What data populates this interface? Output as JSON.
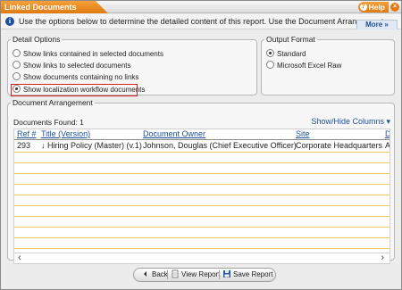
{
  "window": {
    "title": "Linked Documents",
    "help_label": "Help",
    "close_symbol": "×"
  },
  "info": {
    "text": "Use the options below to determine the detailed content of this report. Use the Document Arrangement",
    "more_label": "More »"
  },
  "detail_options": {
    "legend": "Detail Options",
    "items": [
      {
        "label": "Show links contained in selected documents",
        "checked": false
      },
      {
        "label": "Show links to selected documents",
        "checked": false
      },
      {
        "label": "Show documents containing no links",
        "checked": false
      },
      {
        "label": "Show localization workflow documents",
        "checked": true
      }
    ]
  },
  "output_format": {
    "legend": "Output Format",
    "items": [
      {
        "label": "Standard",
        "checked": true
      },
      {
        "label": "Microsoft Excel Raw",
        "checked": false
      }
    ]
  },
  "document_arrangement": {
    "legend": "Document Arrangement",
    "found_label": "Documents Found: 1",
    "show_hide_label": "Show/Hide Columns ▾",
    "columns": [
      "Ref #",
      "Title (Version)",
      "Document Owner",
      "Site",
      "De"
    ],
    "rows": [
      [
        "293",
        "↓ Hiring Policy (Master) (v.1)",
        "Johnson, Douglas (Chief Executive Officer)",
        "Corporate Headquarters",
        "Ac"
      ]
    ]
  },
  "buttons": {
    "back": "Back",
    "view_report": "View Report",
    "save_report": "Save Report"
  },
  "colors": {
    "accent_orange": "#e07a10",
    "link_blue": "#1f4f9a",
    "highlight_red": "#d62020"
  },
  "icons": [
    "help-icon",
    "close-icon",
    "info-icon",
    "back-icon",
    "view-report-icon",
    "save-icon",
    "scroll-left-icon",
    "scroll-right-icon"
  ]
}
